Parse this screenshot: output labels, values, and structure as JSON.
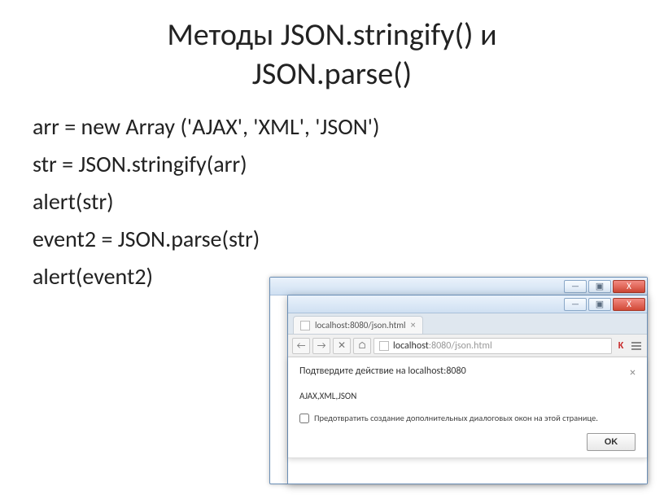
{
  "slide": {
    "title_line1": "Методы JSON.stringify() и",
    "title_line2": "JSON.parse()",
    "code": [
      "arr = new Array ('AJAX', 'XML', 'JSON')",
      "str = JSON.stringify(arr)",
      "alert(str)",
      "event2 = JSON.parse(str)",
      "alert(event2)"
    ]
  },
  "browser": {
    "tab_title": "localhost:8080/json.html",
    "url_host": "localhost",
    "url_rest": ":8080/json.html",
    "win_min": "—",
    "win_max": "▣",
    "win_close": "X",
    "nav_back": "←",
    "nav_fwd": "→",
    "nav_reload": "✕",
    "nav_home": "⌂",
    "tab_close": "×"
  },
  "dialog": {
    "title": "Подтвердите действие на localhost:8080",
    "message": "AJAX,XML,JSON",
    "checkbox_label": "Предотвратить создание дополнительных диалоговых окон на этой странице.",
    "ok_label": "OK",
    "close_glyph": "×"
  }
}
